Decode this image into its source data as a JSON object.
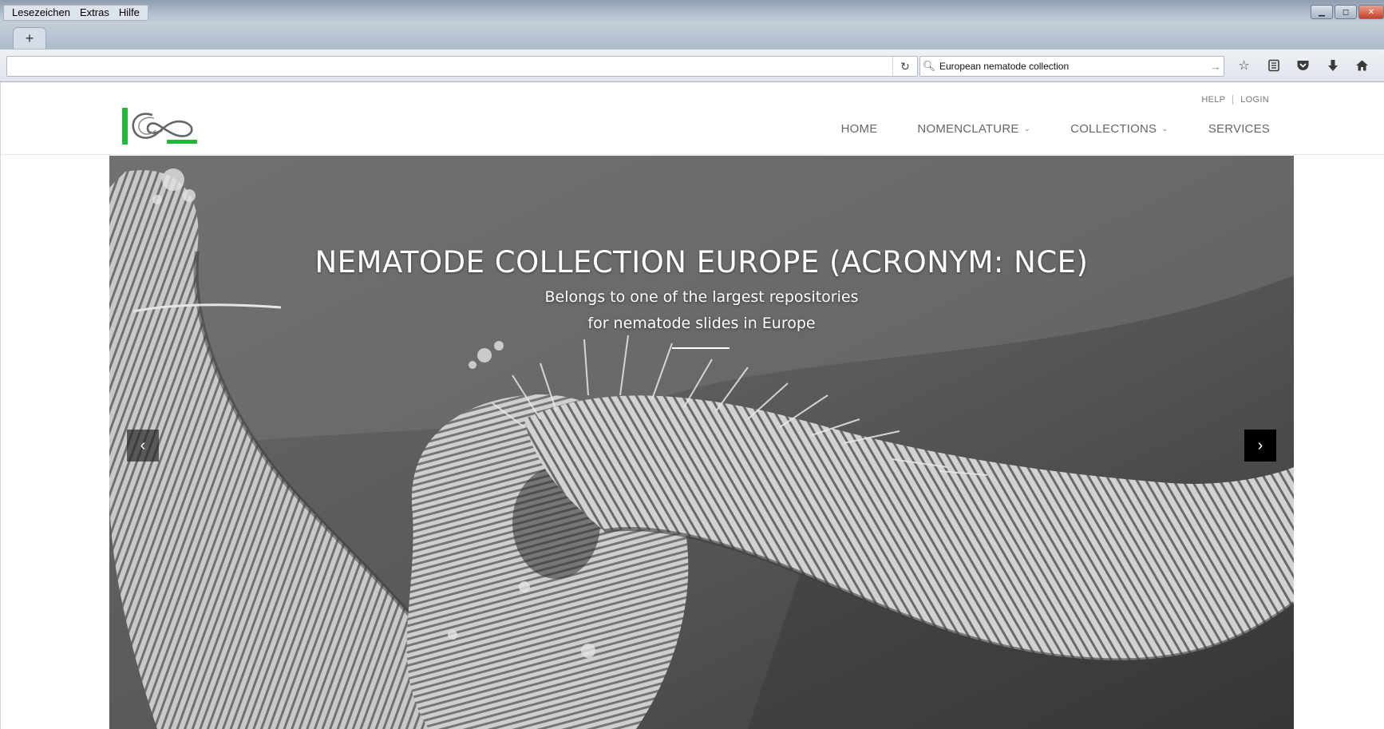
{
  "browser": {
    "menu": [
      "Lesezeichen",
      "Extras",
      "Hilfe"
    ],
    "new_tab_label": "+",
    "search_value": "European nematode collection",
    "url_value": ""
  },
  "site": {
    "top_links": {
      "help": "HELP",
      "login": "LOGIN"
    },
    "nav": [
      {
        "label": "HOME",
        "has_dropdown": false
      },
      {
        "label": "NOMENCLATURE",
        "has_dropdown": true
      },
      {
        "label": "COLLECTIONS",
        "has_dropdown": true
      },
      {
        "label": "SERVICES",
        "has_dropdown": false
      }
    ],
    "logo_colors": {
      "bar": "#1fb83a",
      "mark": "#555555"
    }
  },
  "hero": {
    "title": "NEMATODE COLLECTION EUROPE (ACRONYM: NCE)",
    "subtitle_line1": "Belongs to one of the largest repositories",
    "subtitle_line2": "for nematode slides in Europe"
  },
  "icons": {
    "reload": "reload-icon",
    "search": "search-icon",
    "go": "arrow-right-icon",
    "toolbar": [
      "star-icon",
      "reading-list-icon",
      "pocket-icon",
      "download-icon",
      "home-icon"
    ],
    "slider": [
      "chevron-left-icon",
      "chevron-right-icon"
    ]
  }
}
